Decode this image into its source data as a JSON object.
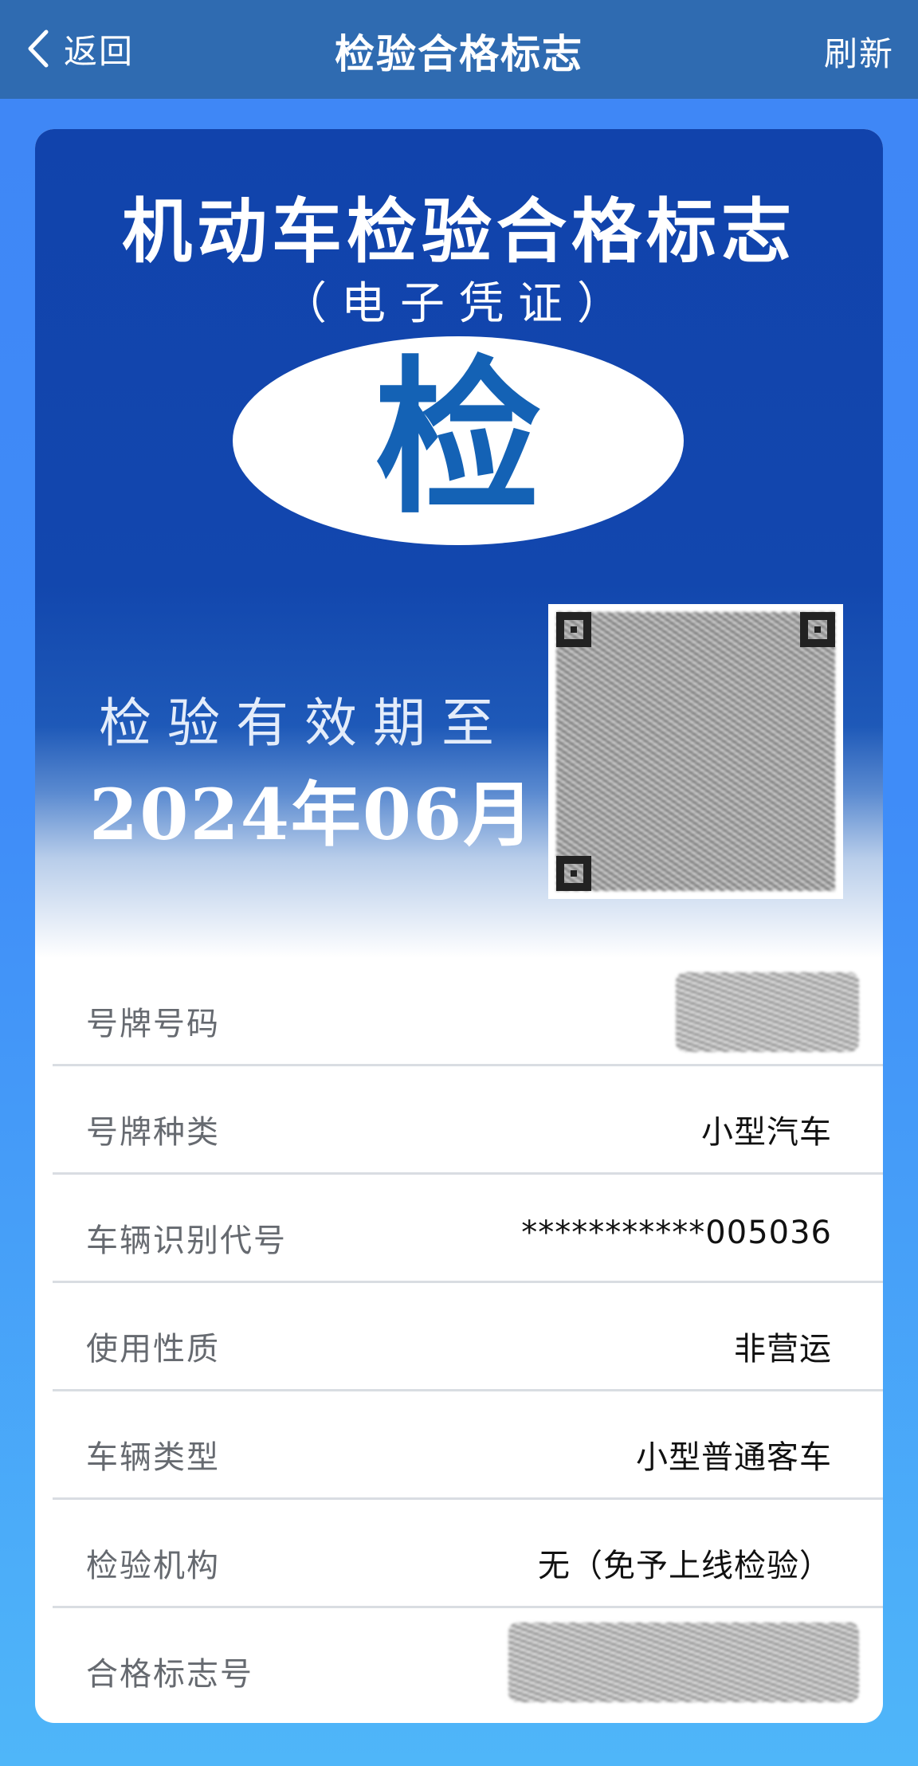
{
  "nav": {
    "back_label": "返回",
    "title": "检验合格标志",
    "refresh_label": "刷新"
  },
  "card": {
    "title": "机动车检验合格标志",
    "subtitle": "（电子凭证）",
    "emblem_char": "检",
    "valid_label": "检验有效期至",
    "valid_date": "2024年06月"
  },
  "rows": [
    {
      "label": "号牌号码",
      "value": ""
    },
    {
      "label": "号牌种类",
      "value": "小型汽车"
    },
    {
      "label": "车辆识别代号",
      "value": "***********005036"
    },
    {
      "label": "使用性质",
      "value": "非营运"
    },
    {
      "label": "车辆类型",
      "value": "小型普通客车"
    },
    {
      "label": "检验机构",
      "value": "无（免予上线检验）"
    },
    {
      "label": "合格标志号",
      "value": ""
    }
  ],
  "colors": {
    "nav_bg": "#2f6bb1",
    "card_blue": "#1143ac",
    "emblem_blue": "#1462b5"
  }
}
